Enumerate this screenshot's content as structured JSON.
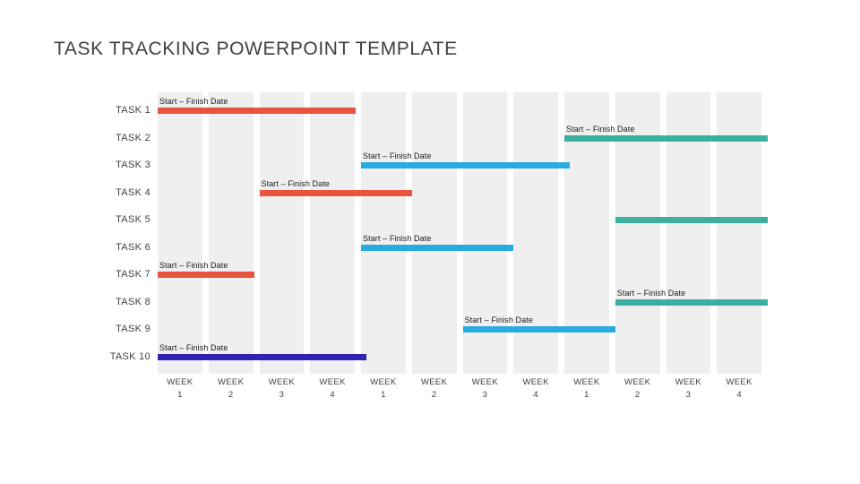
{
  "slide": {
    "title": "TASK TRACKING POWERPOINT TEMPLATE",
    "background_color": "#ffffff",
    "title_color": "#404040"
  },
  "colors": {
    "band": "#efefef",
    "orange_red": "#e8543f",
    "teal": "#3cb0a0",
    "blue": "#29abe2",
    "indigo": "#2f23b5",
    "text": "#3f3f3f",
    "caption_text": "#1a1a1a"
  },
  "caption_text": "Start – Finish Date",
  "tasks": [
    {
      "label": "TASK 1",
      "caption": "Start – Finish Date",
      "color": "#e8543f",
      "start_week": 1,
      "end_week": 4
    },
    {
      "label": "TASK 2",
      "caption": "Start – Finish Date",
      "color": "#3cb0a0",
      "start_week": 9,
      "end_week": 12
    },
    {
      "label": "TASK 3",
      "caption": "Start – Finish Date",
      "color": "#29abe2",
      "start_week": 5,
      "end_week": 8
    },
    {
      "label": "TASK 4",
      "caption": "Start – Finish Date",
      "color": "#e8543f",
      "start_week": 3,
      "end_week": 5
    },
    {
      "label": "TASK 5",
      "caption": "",
      "color": "#3cb0a0",
      "start_week": 10,
      "end_week": 12
    },
    {
      "label": "TASK 6",
      "caption": "Start – Finish Date",
      "color": "#29abe2",
      "start_week": 5,
      "end_week": 7
    },
    {
      "label": "TASK 7",
      "caption": "Start – Finish Date",
      "color": "#e8543f",
      "start_week": 1,
      "end_week": 2
    },
    {
      "label": "TASK 8",
      "caption": "Start – Finish Date",
      "color": "#3cb0a0",
      "start_week": 10,
      "end_week": 12
    },
    {
      "label": "TASK 9",
      "caption": "Start – Finish Date",
      "color": "#29abe2",
      "start_week": 7,
      "end_week": 10
    },
    {
      "label": "TASK 10",
      "caption": "Start – Finish Date",
      "color": "#2f23b5",
      "start_week": 1,
      "end_week": 5
    }
  ],
  "week_axis": [
    {
      "name": "WEEK",
      "number": "1"
    },
    {
      "name": "WEEK",
      "number": "2"
    },
    {
      "name": "WEEK",
      "number": "3"
    },
    {
      "name": "WEEK",
      "number": "4"
    },
    {
      "name": "WEEK",
      "number": "1"
    },
    {
      "name": "WEEK",
      "number": "2"
    },
    {
      "name": "WEEK",
      "number": "3"
    },
    {
      "name": "WEEK",
      "number": "4"
    },
    {
      "name": "WEEK",
      "number": "1"
    },
    {
      "name": "WEEK",
      "number": "2"
    },
    {
      "name": "WEEK",
      "number": "3"
    },
    {
      "name": "WEEK",
      "number": "4"
    }
  ],
  "chart_data": {
    "type": "bar",
    "title": "TASK TRACKING POWERPOINT TEMPLATE",
    "subtitle": "",
    "xlabel": "",
    "ylabel": "",
    "orientation": "horizontal",
    "chart_style": "gantt",
    "grid": "vertical-bands",
    "legend": "none",
    "categories": [
      "TASK 1",
      "TASK 2",
      "TASK 3",
      "TASK 4",
      "TASK 5",
      "TASK 6",
      "TASK 7",
      "TASK 8",
      "TASK 9",
      "TASK 10"
    ],
    "x_tick_labels": [
      "WEEK 1",
      "WEEK 2",
      "WEEK 3",
      "WEEK 4",
      "WEEK 1",
      "WEEK 2",
      "WEEK 3",
      "WEEK 4",
      "WEEK 1",
      "WEEK 2",
      "WEEK 3",
      "WEEK 4"
    ],
    "xlim": [
      1,
      13
    ],
    "bars": [
      {
        "category": "TASK 1",
        "start": 1,
        "end": 4.9,
        "duration": 3.9,
        "color": "#e8543f",
        "label": "Start – Finish Date"
      },
      {
        "category": "TASK 2",
        "start": 9,
        "end": 13,
        "duration": 4.0,
        "color": "#3cb0a0",
        "label": "Start – Finish Date"
      },
      {
        "category": "TASK 3",
        "start": 5,
        "end": 9.1,
        "duration": 4.1,
        "color": "#29abe2",
        "label": "Start – Finish Date"
      },
      {
        "category": "TASK 4",
        "start": 3,
        "end": 6.0,
        "duration": 3.0,
        "color": "#e8543f",
        "label": "Start – Finish Date"
      },
      {
        "category": "TASK 5",
        "start": 10,
        "end": 13,
        "duration": 3.0,
        "color": "#3cb0a0",
        "label": ""
      },
      {
        "category": "TASK 6",
        "start": 5,
        "end": 8.0,
        "duration": 3.0,
        "color": "#29abe2",
        "label": "Start – Finish Date"
      },
      {
        "category": "TASK 7",
        "start": 1,
        "end": 2.9,
        "duration": 1.9,
        "color": "#e8543f",
        "label": "Start – Finish Date"
      },
      {
        "category": "TASK 8",
        "start": 10,
        "end": 13,
        "duration": 3.0,
        "color": "#3cb0a0",
        "label": "Start – Finish Date"
      },
      {
        "category": "TASK 9",
        "start": 7,
        "end": 10.0,
        "duration": 3.0,
        "color": "#29abe2",
        "label": "Start – Finish Date"
      },
      {
        "category": "TASK 10",
        "start": 1,
        "end": 5.1,
        "duration": 4.1,
        "color": "#2f23b5",
        "label": "Start – Finish Date"
      }
    ]
  }
}
